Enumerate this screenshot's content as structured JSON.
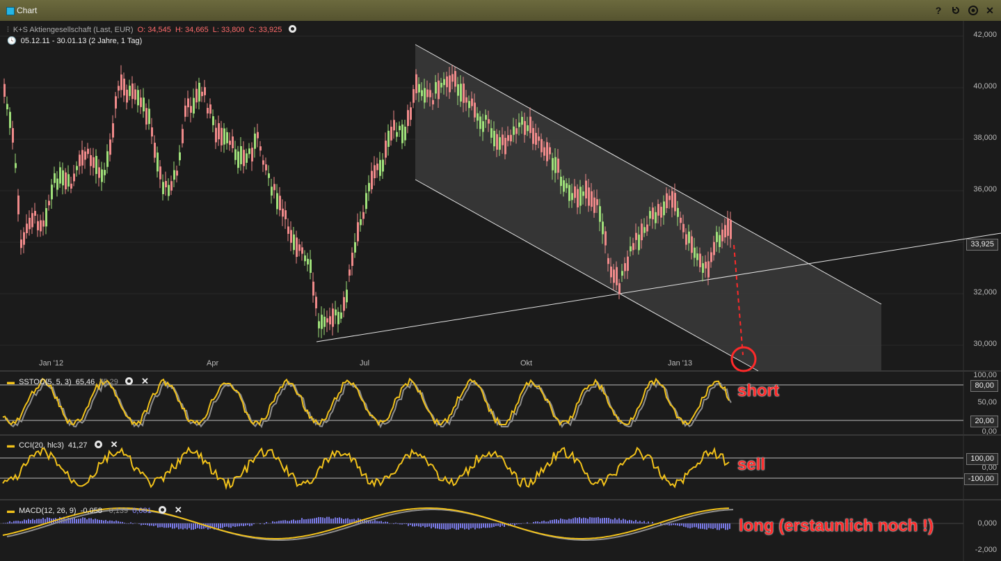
{
  "window": {
    "title": "Chart",
    "buttons": [
      "help-icon",
      "reset-icon",
      "target-icon",
      "close-icon"
    ],
    "help_label": "?",
    "close_label": "✕"
  },
  "header": {
    "symbol": "K+S Aktiengesellschaft (Last, EUR)",
    "open": "O: 34,545",
    "high": "H: 34,665",
    "low": "L: 33,800",
    "close": "C: 33,925",
    "range": "05.12.11 - 30.01.13 (2 Jahre, 1 Tag)"
  },
  "colors": {
    "up": "#9fe07a",
    "down": "#f08a8a",
    "stoch_main": "#f2c21a",
    "stoch_signal": "#8f8f8f",
    "macd_hist": "#7a7ae6",
    "annotation": "#ff2a2a"
  },
  "price_axis": {
    "ticks": [
      "42,000",
      "40,000",
      "38,000",
      "36,000",
      "34,000",
      "32,000",
      "30,000"
    ],
    "current": "33,925"
  },
  "time_axis": [
    "Jan '12",
    "Apr",
    "Jul",
    "Okt",
    "Jan '13"
  ],
  "indicators": {
    "stoch": {
      "label": "SSTOC(5, 5, 3)",
      "value1": "65,46",
      "value2": "75,29",
      "ticks": [
        "100,00",
        "80,00",
        "50,00",
        "20,00",
        "0,00"
      ]
    },
    "cci": {
      "label": "CCI(20, hlc3)",
      "value": "41,27",
      "ticks": [
        "100,00",
        "0,00",
        "-100,00"
      ]
    },
    "macd": {
      "label": "MACD(12, 26, 9)",
      "value1": "-0,058",
      "value2": "-0,139",
      "value3": "0,081",
      "ticks": [
        "0,000",
        "-2,000"
      ]
    }
  },
  "annotations": {
    "short": "short",
    "sell": "sell",
    "long": "long (erstaunlich noch !)"
  }
}
